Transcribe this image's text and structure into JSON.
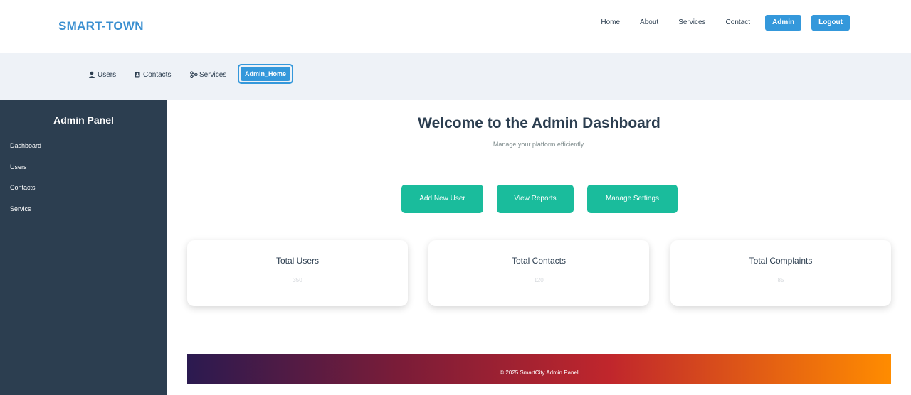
{
  "brand": "SMART-TOWN",
  "topnav": {
    "links": [
      "Home",
      "About",
      "Services",
      "Contact"
    ],
    "admin": "Admin",
    "logout": "Logout"
  },
  "subnav": {
    "users": "Users",
    "contacts": "Contacts",
    "services": "Services",
    "admin_home": "Admin_Home"
  },
  "sidebar": {
    "title": "Admin Panel",
    "items": [
      "Dashboard",
      "Users",
      "Contacts",
      "Servics"
    ]
  },
  "main": {
    "title": "Welcome to the Admin Dashboard",
    "subtitle": "Manage your platform efficiently.",
    "actions": [
      "Add New User",
      "View Reports",
      "Manage Settings"
    ]
  },
  "cards": [
    {
      "title": "Total Users",
      "value": "350"
    },
    {
      "title": "Total Contacts",
      "value": "120"
    },
    {
      "title": "Total Complaints",
      "value": "85"
    }
  ],
  "footer": "© 2025 SmartCity Admin Panel",
  "colors": {
    "brand": "#3a8fd0",
    "primary": "#3498db",
    "sidebar": "#2c3e50",
    "action": "#1abc9c"
  },
  "icons": {
    "users": "user-icon",
    "contacts": "address-book-icon",
    "services": "network-icon"
  }
}
